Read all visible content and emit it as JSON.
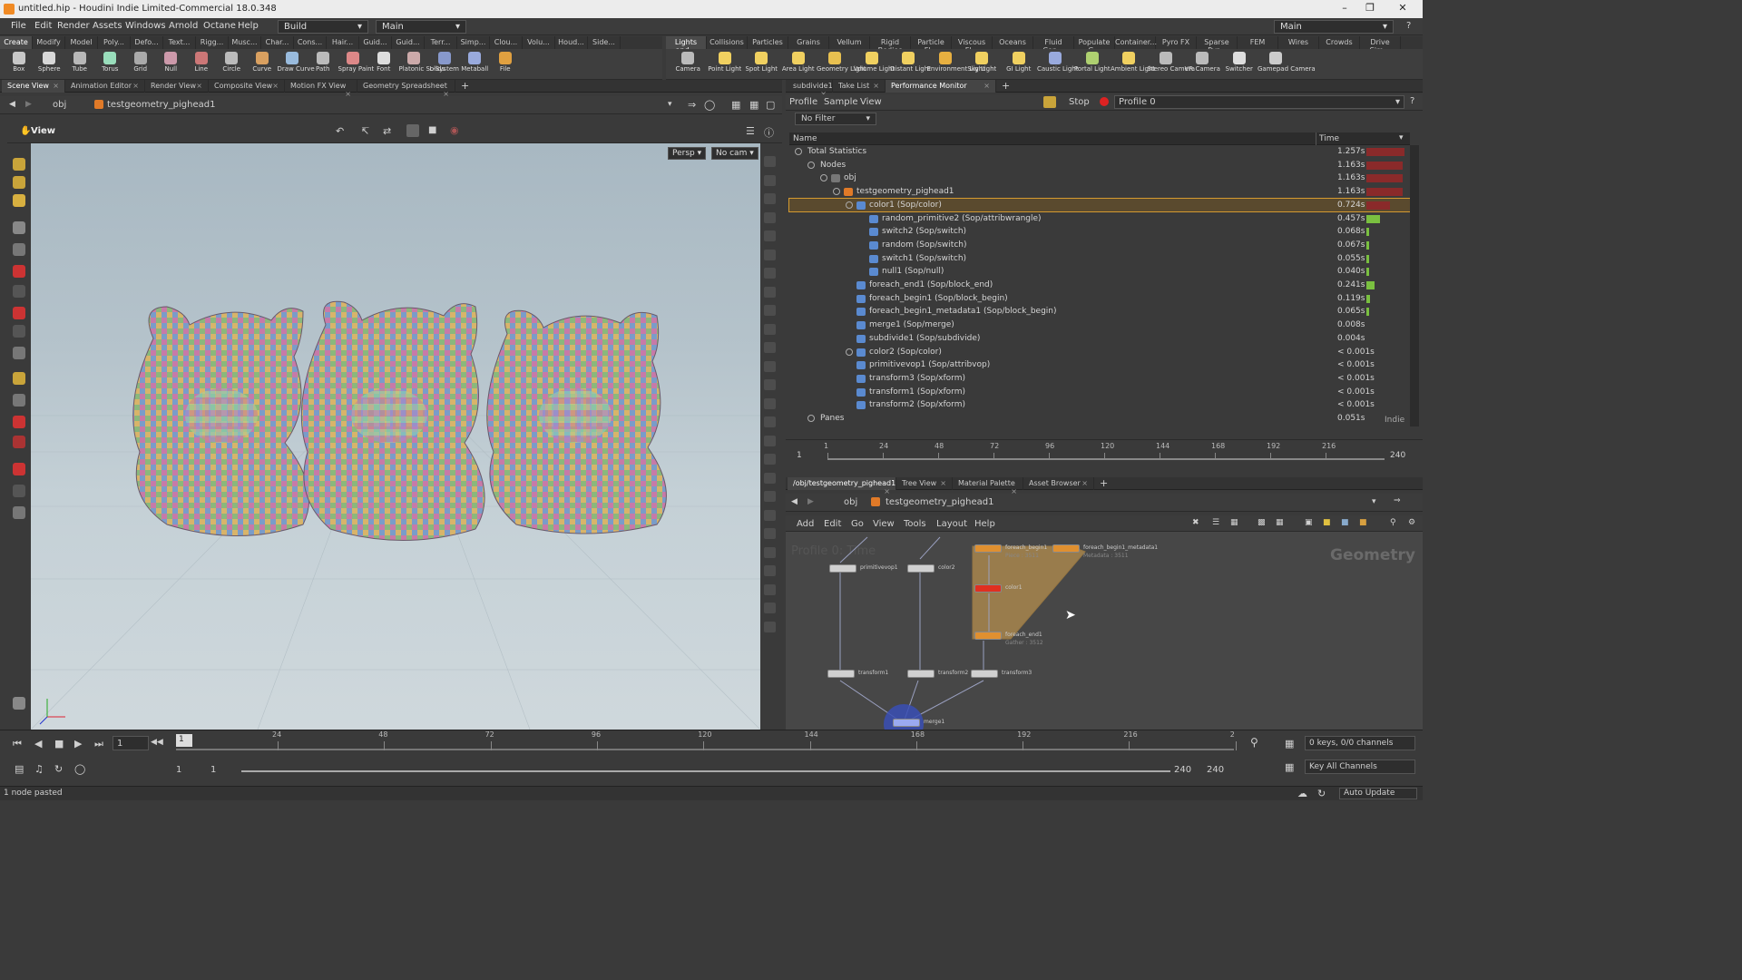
{
  "window": {
    "title": "untitled.hip - Houdini Indie Limited-Commercial 18.0.348"
  },
  "menu": [
    "File",
    "Edit",
    "Render",
    "Assets",
    "Windows",
    "Arnold",
    "Octane",
    "Help"
  ],
  "desktop_selector": "Build",
  "desktop_main": "Main",
  "top_right_main": "Main",
  "shelf_tabs_left": [
    "Create",
    "Modify",
    "Model",
    "Poly...",
    "Defo...",
    "Text...",
    "Rigg...",
    "Musc...",
    "Char...",
    "Cons...",
    "Hair...",
    "Guid...",
    "Guid...",
    "Terr...",
    "Simp...",
    "Clou...",
    "Volu...",
    "Houd...",
    "Side..."
  ],
  "shelf_tools_left": [
    {
      "label": "Box",
      "icon": "box-icon"
    },
    {
      "label": "Sphere",
      "icon": "sphere-icon"
    },
    {
      "label": "Tube",
      "icon": "tube-icon"
    },
    {
      "label": "Torus",
      "icon": "torus-icon"
    },
    {
      "label": "Grid",
      "icon": "grid-icon"
    },
    {
      "label": "Null",
      "icon": "null-icon"
    },
    {
      "label": "Line",
      "icon": "line-icon"
    },
    {
      "label": "Circle",
      "icon": "circle-icon"
    },
    {
      "label": "Curve",
      "icon": "curve-icon"
    },
    {
      "label": "Draw Curve",
      "icon": "draw-curve-icon"
    },
    {
      "label": "Path",
      "icon": "path-icon"
    },
    {
      "label": "Spray Paint",
      "icon": "spray-paint-icon"
    },
    {
      "label": "Font",
      "icon": "font-icon"
    },
    {
      "label": "Platonic Solids",
      "icon": "platonic-icon"
    },
    {
      "label": "L-System",
      "icon": "lsystem-icon"
    },
    {
      "label": "Metaball",
      "icon": "metaball-icon"
    },
    {
      "label": "File",
      "icon": "file-icon"
    }
  ],
  "shelf_tabs_right": [
    "Lights and...",
    "Collisions",
    "Particles",
    "Grains",
    "Vellum",
    "Rigid Bodies",
    "Particle Fl...",
    "Viscous Fl...",
    "Oceans",
    "Fluid Con...",
    "Populate C...",
    "Container...",
    "Pyro FX",
    "Sparse Pyr...",
    "FEM",
    "Wires",
    "Crowds",
    "Drive Sim..."
  ],
  "shelf_tools_right": [
    {
      "label": "Camera",
      "icon": "camera-icon"
    },
    {
      "label": "Point Light",
      "icon": "point-light-icon"
    },
    {
      "label": "Spot Light",
      "icon": "spot-light-icon"
    },
    {
      "label": "Area Light",
      "icon": "area-light-icon"
    },
    {
      "label": "Geometry Light",
      "icon": "geometry-light-icon"
    },
    {
      "label": "Volume Light",
      "icon": "volume-light-icon"
    },
    {
      "label": "Distant Light",
      "icon": "distant-light-icon"
    },
    {
      "label": "Environment Light",
      "icon": "environment-light-icon"
    },
    {
      "label": "Sky Light",
      "icon": "sky-light-icon"
    },
    {
      "label": "GI Light",
      "icon": "gi-light-icon"
    },
    {
      "label": "Caustic Light",
      "icon": "caustic-light-icon"
    },
    {
      "label": "Portal Light",
      "icon": "portal-light-icon"
    },
    {
      "label": "Ambient Light",
      "icon": "ambient-light-icon"
    },
    {
      "label": "Stereo Camera",
      "icon": "stereo-camera-icon"
    },
    {
      "label": "VR Camera",
      "icon": "vr-camera-icon"
    },
    {
      "label": "Switcher",
      "icon": "switcher-icon"
    },
    {
      "label": "Gamepad Camera",
      "icon": "gamepad-camera-icon"
    }
  ],
  "left_pane_tabs": [
    "Scene View",
    "Animation Editor",
    "Render View",
    "Composite View",
    "Motion FX View",
    "Geometry Spreadsheet"
  ],
  "left_path": {
    "root": "obj",
    "node": "testgeometry_pighead1"
  },
  "viewport": {
    "label": "View",
    "persp": "Persp",
    "cam": "No cam"
  },
  "right_pane_tabs": [
    "subdivide1",
    "Take List",
    "Performance Monitor"
  ],
  "perf": {
    "menus": [
      "Profile",
      "Sample",
      "View"
    ],
    "stop": "Stop",
    "profile": "Profile 0",
    "filter": "No Filter",
    "col_name": "Name",
    "col_time": "Time",
    "indie": "Indie",
    "rows": [
      {
        "name": "Total Statistics",
        "time": "1.257s",
        "indent": 0,
        "bar": "red",
        "fill": 0.95
      },
      {
        "name": "Nodes",
        "time": "1.163s",
        "indent": 1,
        "bar": "red",
        "fill": 0.9
      },
      {
        "name": "obj",
        "time": "1.163s",
        "indent": 2,
        "bar": "red",
        "fill": 0.9
      },
      {
        "name": "testgeometry_pighead1",
        "time": "1.163s",
        "indent": 3,
        "bar": "red",
        "fill": 0.9
      },
      {
        "name": "color1 (Sop/color)",
        "time": "0.724s",
        "indent": 4,
        "bar": "red",
        "fill": 0.6,
        "selected": true
      },
      {
        "name": "random_primitive2 (Sop/attribwrangle)",
        "time": "0.457s",
        "indent": 5,
        "bar": "green",
        "fill": 0.35
      },
      {
        "name": "switch2 (Sop/switch)",
        "time": "0.068s",
        "indent": 5,
        "bar": "green",
        "fill": 0.05
      },
      {
        "name": "random (Sop/switch)",
        "time": "0.067s",
        "indent": 5,
        "bar": "green",
        "fill": 0.05
      },
      {
        "name": "switch1 (Sop/switch)",
        "time": "0.055s",
        "indent": 5,
        "bar": "green",
        "fill": 0.05
      },
      {
        "name": "null1 (Sop/null)",
        "time": "0.040s",
        "indent": 5,
        "bar": "green",
        "fill": 0.04
      },
      {
        "name": "foreach_end1 (Sop/block_end)",
        "time": "0.241s",
        "indent": 4,
        "bar": "green",
        "fill": 0.2
      },
      {
        "name": "foreach_begin1 (Sop/block_begin)",
        "time": "0.119s",
        "indent": 4,
        "bar": "green",
        "fill": 0.1
      },
      {
        "name": "foreach_begin1_metadata1 (Sop/block_begin)",
        "time": "0.065s",
        "indent": 4,
        "bar": "green",
        "fill": 0.05
      },
      {
        "name": "merge1 (Sop/merge)",
        "time": "0.008s",
        "indent": 4,
        "bar": "none",
        "fill": 0
      },
      {
        "name": "subdivide1 (Sop/subdivide)",
        "time": "0.004s",
        "indent": 4,
        "bar": "none",
        "fill": 0
      },
      {
        "name": "color2 (Sop/color)",
        "time": "< 0.001s",
        "indent": 4,
        "bar": "none",
        "fill": 0
      },
      {
        "name": "primitivevop1 (Sop/attribvop)",
        "time": "< 0.001s",
        "indent": 4,
        "bar": "none",
        "fill": 0
      },
      {
        "name": "transform3 (Sop/xform)",
        "time": "< 0.001s",
        "indent": 4,
        "bar": "none",
        "fill": 0
      },
      {
        "name": "transform1 (Sop/xform)",
        "time": "< 0.001s",
        "indent": 4,
        "bar": "none",
        "fill": 0
      },
      {
        "name": "transform2 (Sop/xform)",
        "time": "< 0.001s",
        "indent": 4,
        "bar": "none",
        "fill": 0
      },
      {
        "name": "Panes",
        "time": "0.051s",
        "indent": 1,
        "bar": "none",
        "fill": 0
      }
    ]
  },
  "perf_timeline": {
    "start": "1",
    "end": "240",
    "ticks": [
      "1",
      "24",
      "48",
      "72",
      "96",
      "120",
      "144",
      "168",
      "192",
      "216"
    ]
  },
  "network_tabs": [
    "/obj/testgeometry_pighead1",
    "Tree View",
    "Material Palette",
    "Asset Browser"
  ],
  "network_path": {
    "root": "obj",
    "node": "testgeometry_pighead1"
  },
  "network_menus": [
    "Add",
    "Edit",
    "Go",
    "View",
    "Tools",
    "Layout",
    "Help"
  ],
  "network": {
    "watermark": "Geometry",
    "profile_label": "Profile 0: Time",
    "nodes": [
      {
        "name": "primitivevop1"
      },
      {
        "name": "color2"
      },
      {
        "name": "foreach_begin1",
        "sub": "Piece : 3511"
      },
      {
        "name": "foreach_begin1_metadata1",
        "sub": "Metadata : 3511"
      },
      {
        "name": "color1"
      },
      {
        "name": "foreach_end1",
        "sub": "Gather : 3512"
      },
      {
        "name": "transform1"
      },
      {
        "name": "transform2"
      },
      {
        "name": "transform3"
      },
      {
        "name": "merge1"
      }
    ]
  },
  "playbar": {
    "frame": "1",
    "start": "1",
    "start2": "1",
    "end": "240",
    "end2": "240",
    "ticks": [
      "24",
      "48",
      "72",
      "96",
      "120",
      "144",
      "168",
      "192",
      "216",
      "2"
    ],
    "keys": "0 keys, 0/0 channels",
    "key_all": "Key All Channels",
    "auto_update": "Auto Update"
  },
  "status": "1 node pasted"
}
